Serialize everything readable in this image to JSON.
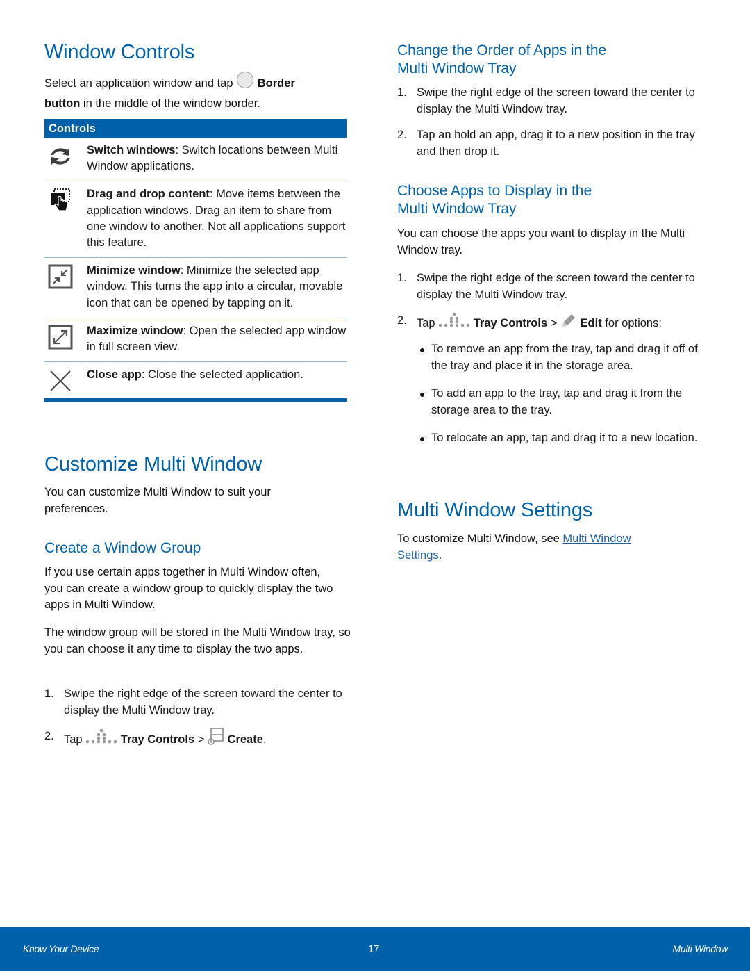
{
  "left": {
    "window_controls": {
      "title": "Window Controls",
      "intro_pre": "Select an application window and tap ",
      "intro_bold1": "Border",
      "intro_bold2": "button",
      "intro_post": " in the middle of the window border.",
      "border_icon": "circle-button-icon",
      "table": {
        "header": "Controls",
        "rows": [
          {
            "icon": "switch-windows-icon",
            "term": "Switch windows",
            "desc": ": Switch locations between Multi Window applications."
          },
          {
            "icon": "drag-drop-icon",
            "term": "Drag and drop content",
            "desc": ": Move items between the application windows. Drag an item to share from one window to another. Not all applications support this feature."
          },
          {
            "icon": "minimize-icon",
            "term": "Minimize window",
            "desc": ": Minimize the selected app window. This turns the app into a circular, movable icon that can be opened by tapping on it."
          },
          {
            "icon": "maximize-icon",
            "term": "Maximize window",
            "desc": ": Open the selected app window in full screen view."
          },
          {
            "icon": "close-icon",
            "term": "Close app",
            "desc": ": Close the selected application."
          }
        ]
      }
    },
    "customize": {
      "title": "Customize Multi Window",
      "intro": "You can customize Multi Window to suit your preferences.",
      "group": {
        "title": "Create a Window Group",
        "p1": "If you use certain apps together in Multi Window often, you can create a window group to quickly display the two apps in Multi Window.",
        "p2": "The window group will be stored in the Multi Window tray, so you can choose it any time to display the two apps.",
        "steps": [
          {
            "num": "1.",
            "text": "Swipe the right edge of the screen toward the center to display the Multi Window tray."
          },
          {
            "num": "2.",
            "pre": "Tap ",
            "bold1": "Tray Controls",
            "mid": " > ",
            "bold2": "Create",
            "post": "."
          }
        ]
      }
    }
  },
  "right": {
    "change_order": {
      "title_line1": "Change the Order of Apps in the",
      "title_line2": "Multi Window Tray",
      "steps": [
        {
          "num": "1.",
          "text": "Swipe the right edge of the screen toward the center to display the Multi Window tray."
        },
        {
          "num": "2.",
          "text": "Tap an hold an app, drag it to a new position in the tray and then drop it."
        }
      ]
    },
    "choose_apps": {
      "title_line1": "Choose Apps to Display in the",
      "title_line2": "Multi Window Tray",
      "intro": "You can choose the apps you want to display in the Multi Window tray.",
      "steps": [
        {
          "num": "1.",
          "text": "Swipe the right edge of the screen toward the center to display the Multi Window tray."
        },
        {
          "num": "2.",
          "pre": "Tap ",
          "bold1": "Tray Controls",
          "mid": " > ",
          "bold2": "Edit",
          "post": " for options:"
        }
      ],
      "bullets": [
        "To remove an app from the tray, tap and drag it off of the tray and place it in the storage area.",
        "To add an app to the tray, tap and drag it from the storage area to the tray.",
        "To relocate an app, tap and drag it to a new location."
      ]
    },
    "settings": {
      "title": "Multi Window Settings",
      "pre": "To customize Multi Window, see ",
      "link": "Multi Window Settings",
      "post": "."
    }
  },
  "footer": {
    "left": "Know Your Device",
    "page": "17",
    "right": "Multi Window",
    "color": "#0061ab"
  },
  "colors": {
    "heading": "#0061ab",
    "link": "#1f5fa8"
  }
}
